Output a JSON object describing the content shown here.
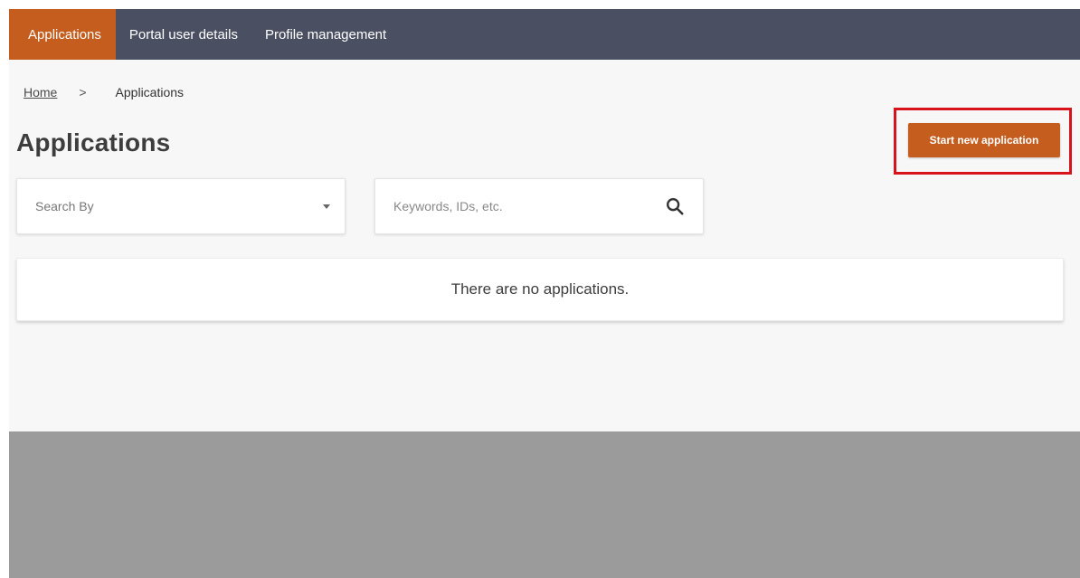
{
  "nav": {
    "items": [
      {
        "label": "Applications",
        "active": true
      },
      {
        "label": "Portal user details",
        "active": false
      },
      {
        "label": "Profile management",
        "active": false
      }
    ]
  },
  "breadcrumb": {
    "home": "Home",
    "separator": ">",
    "current": "Applications"
  },
  "page": {
    "title": "Applications",
    "start_button_label": "Start new application"
  },
  "filters": {
    "search_by_label": "Search By",
    "search_placeholder": "Keywords, IDs, etc."
  },
  "results": {
    "empty_message": "There are no applications."
  },
  "colors": {
    "nav_bg": "#4a5061",
    "accent": "#c55d1e",
    "highlight": "#d7131c"
  },
  "icons": {
    "search": "search-icon",
    "dropdown": "chevron-down-icon"
  }
}
